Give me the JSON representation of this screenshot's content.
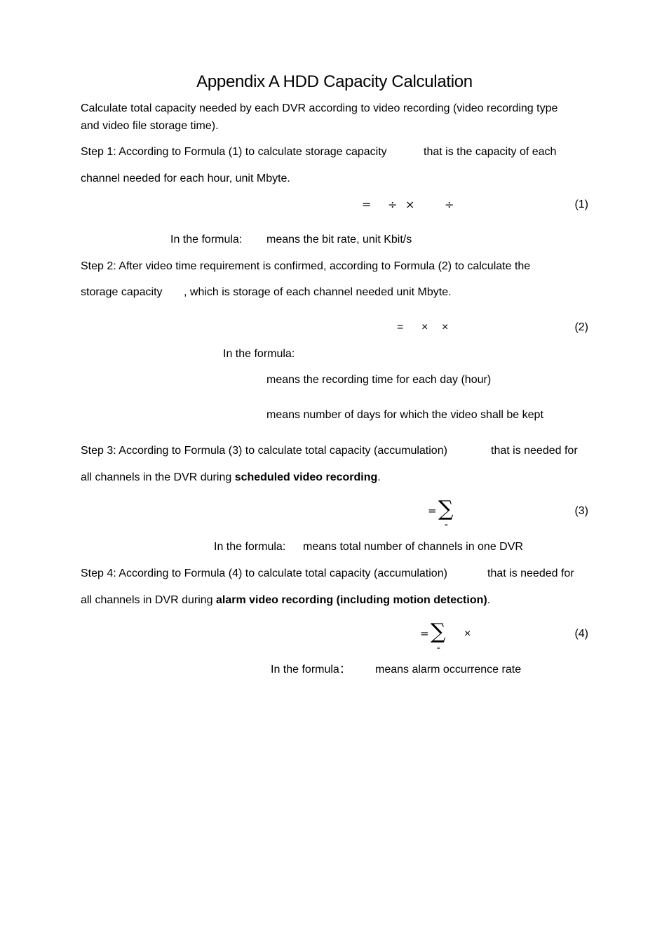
{
  "title": "Appendix A  HDD Capacity Calculation",
  "intro": {
    "line1": "Calculate total capacity needed by each DVR according to video recording (video recording type",
    "line2": "and video file storage time)."
  },
  "step1": {
    "line1a": "Step 1: According to Formula (1) to calculate storage capacity",
    "line1b": "that is the capacity of each",
    "line2": "channel needed for each hour, unit Mbyte.",
    "formula": {
      "eq": "=",
      "op1": "÷",
      "op2": "×",
      "op3": "÷",
      "number": "(1)"
    },
    "note_label": "In the formula:",
    "note_text": "means the bit rate, unit Kbit/s"
  },
  "step2": {
    "line1": "Step 2: After video time requirement is confirmed, according to Formula (2) to calculate the",
    "line2a": "storage capacity",
    "line2b": ", which is storage of each channel needed unit Mbyte.",
    "formula": {
      "eq": "=",
      "op1": "×",
      "op2": "×",
      "number": "(2)"
    },
    "note_label": "In the formula:",
    "note_items": [
      "means the recording time for each day (hour)",
      "means number of days for which the video shall be kept"
    ]
  },
  "step3": {
    "line1a": "Step 3: According to Formula (3) to calculate total capacity (accumulation)",
    "line1b": "that is needed for",
    "line2_plain": "all channels in the DVR during ",
    "line2_bold": "scheduled video recording",
    "line2_end": ".",
    "formula": {
      "eq": "=",
      "sigma": "∑",
      "sub": "=",
      "number": "(3)"
    },
    "note_label": "In the formula:",
    "note_text": "means total number of channels in one DVR"
  },
  "step4": {
    "line1a": "Step 4: According to Formula (4) to calculate total capacity (accumulation)",
    "line1b": "that is needed for",
    "line2_plain": "all channels in DVR during ",
    "line2_bold": "alarm video recording (including motion detection)",
    "line2_end": ".",
    "formula": {
      "eq": "=",
      "sigma": "∑",
      "sub": "=",
      "op1": "×",
      "number": "(4)"
    },
    "note_label": "In the formula：",
    "note_text": "means alarm occurrence rate"
  }
}
